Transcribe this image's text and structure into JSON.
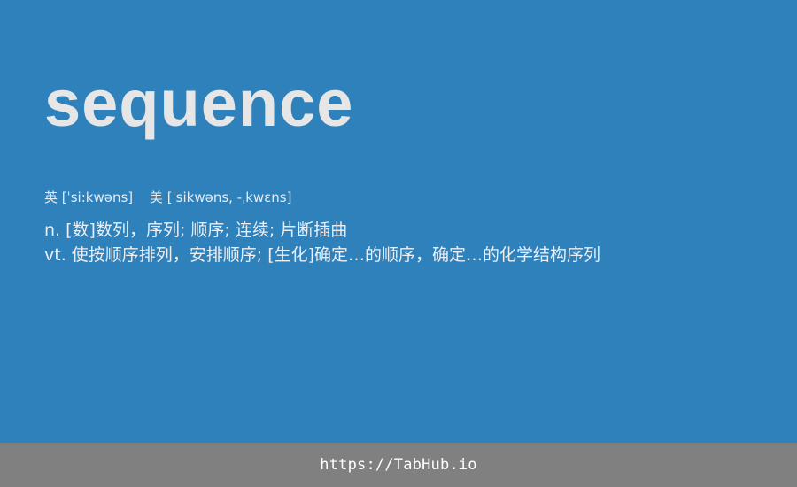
{
  "entry": {
    "word": "sequence",
    "phonetic_uk": "英 [ˈsi:kwəns]",
    "phonetic_us": "美 [ˈsikwəns, -ˌkwɛns]",
    "definitions": [
      "n. [数]数列，序列; 顺序; 连续; 片断插曲",
      "vt. 使按顺序排列，安排顺序; [生化]确定…的顺序，确定…的化学结构序列"
    ]
  },
  "footer": {
    "link_text": "https://TabHub.io"
  },
  "colors": {
    "background": "#2f81bb",
    "word": "#e6e6e6",
    "footer_background": "#808080"
  }
}
